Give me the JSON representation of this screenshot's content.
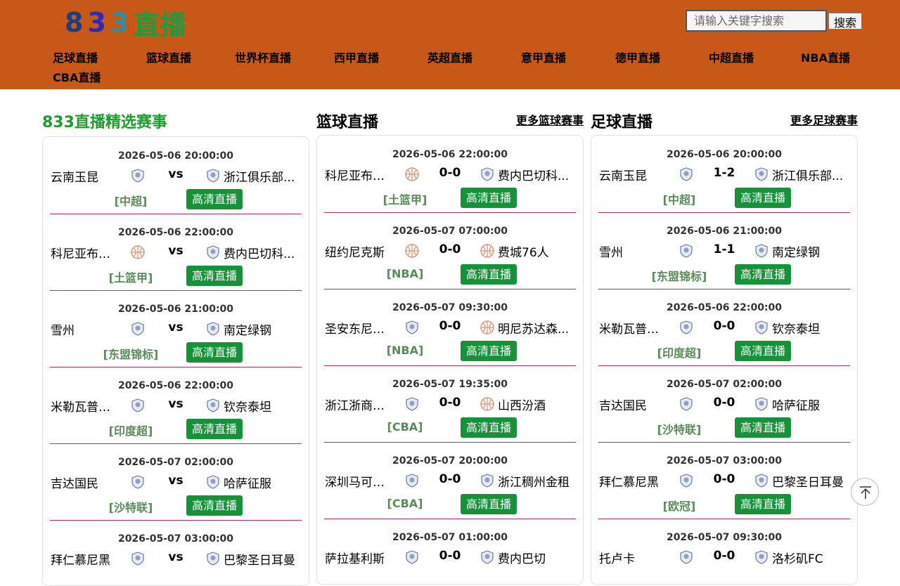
{
  "site": {
    "logo": [
      "8",
      "3",
      "3",
      "直播"
    ],
    "search_placeholder": "请输入关键字搜索",
    "search_button": "搜索"
  },
  "nav": [
    "足球直播",
    "篮球直播",
    "世界杯直播",
    "西甲直播",
    "英超直播",
    "意甲直播",
    "德甲直播",
    "中超直播",
    "NBA直播",
    "CBA直播"
  ],
  "columns": [
    {
      "title": "833直播精选赛事",
      "more": "",
      "matches": [
        {
          "time": "2026-05-06 20:00:00",
          "home": "云南玉昆",
          "score": "vs",
          "away": "浙江俱乐部...",
          "league": "[中超]",
          "live": "高清直播",
          "home_icon": "shield-icon",
          "away_icon": "shield-icon"
        },
        {
          "time": "2026-05-06 22:00:00",
          "home": "科尼亚布于...",
          "score": "vs",
          "away": "费内巴切科...",
          "league": "[土篮甲]",
          "live": "高清直播",
          "home_icon": "ball-icon",
          "away_icon": "shield-icon"
        },
        {
          "time": "2026-05-06 21:00:00",
          "home": "雪州",
          "score": "vs",
          "away": "南定绿钢",
          "league": "[东盟锦标]",
          "live": "高清直播",
          "home_icon": "shield-icon",
          "away_icon": "shield-icon"
        },
        {
          "time": "2026-05-06 22:00:00",
          "home": "米勒瓦普甲比",
          "score": "vs",
          "away": "钦奈泰坦",
          "league": "[印度超]",
          "live": "高清直播",
          "home_icon": "shield-icon",
          "away_icon": "shield-icon"
        },
        {
          "time": "2026-05-07 02:00:00",
          "home": "吉达国民",
          "score": "vs",
          "away": "哈萨征服",
          "league": "[沙特联]",
          "live": "高清直播",
          "home_icon": "shield-icon",
          "away_icon": "shield-icon"
        },
        {
          "time": "2026-05-07 03:00:00",
          "home": "拜仁慕尼黑",
          "score": "vs",
          "away": "巴黎圣日耳曼",
          "league": "",
          "live": "",
          "home_icon": "shield-icon",
          "away_icon": "shield-icon"
        }
      ]
    },
    {
      "title": "篮球直播",
      "more": "更多篮球赛事",
      "matches": [
        {
          "time": "2026-05-06 22:00:00",
          "home": "科尼亚布于...",
          "score": "0-0",
          "away": "费内巴切科...",
          "league": "[土篮甲]",
          "live": "高清直播",
          "home_icon": "ball-icon",
          "away_icon": "shield-icon"
        },
        {
          "time": "2026-05-07 07:00:00",
          "home": "纽约尼克斯",
          "score": "0-0",
          "away": "费城76人",
          "league": "[NBA]",
          "live": "高清直播",
          "home_icon": "ball-icon",
          "away_icon": "ball-icon"
        },
        {
          "time": "2026-05-07 09:30:00",
          "home": "圣安东尼奥...",
          "score": "0-0",
          "away": "明尼苏达森...",
          "league": "[NBA]",
          "live": "高清直播",
          "home_icon": "shield-icon",
          "away_icon": "ball-icon"
        },
        {
          "time": "2026-05-07 19:35:00",
          "home": "浙江浙商证券",
          "score": "0-0",
          "away": "山西汾酒",
          "league": "[CBA]",
          "live": "高清直播",
          "home_icon": "shield-icon",
          "away_icon": "ball-icon"
        },
        {
          "time": "2026-05-07 20:00:00",
          "home": "深圳马可波罗",
          "score": "0-0",
          "away": "浙江稠州金租",
          "league": "[CBA]",
          "live": "高清直播",
          "home_icon": "shield-icon",
          "away_icon": "shield-icon"
        },
        {
          "time": "2026-05-07 01:00:00",
          "home": "萨拉基利斯",
          "score": "0-0",
          "away": "费内巴切",
          "league": "",
          "live": "",
          "home_icon": "shield-icon",
          "away_icon": "shield-icon"
        }
      ]
    },
    {
      "title": "足球直播",
      "more": "更多足球赛事",
      "matches": [
        {
          "time": "2026-05-06 20:00:00",
          "home": "云南玉昆",
          "score": "1-2",
          "away": "浙江俱乐部...",
          "league": "[中超]",
          "live": "高清直播",
          "home_icon": "shield-icon",
          "away_icon": "shield-icon"
        },
        {
          "time": "2026-05-06 21:00:00",
          "home": "雪州",
          "score": "1-1",
          "away": "南定绿钢",
          "league": "[东盟锦标]",
          "live": "高清直播",
          "home_icon": "shield-icon",
          "away_icon": "shield-icon"
        },
        {
          "time": "2026-05-06 22:00:00",
          "home": "米勒瓦普甲比",
          "score": "0-0",
          "away": "钦奈泰坦",
          "league": "[印度超]",
          "live": "高清直播",
          "home_icon": "shield-icon",
          "away_icon": "shield-icon"
        },
        {
          "time": "2026-05-07 02:00:00",
          "home": "吉达国民",
          "score": "0-0",
          "away": "哈萨征服",
          "league": "[沙特联]",
          "live": "高清直播",
          "home_icon": "shield-icon",
          "away_icon": "shield-icon"
        },
        {
          "time": "2026-05-07 03:00:00",
          "home": "拜仁慕尼黑",
          "score": "0-0",
          "away": "巴黎圣日耳曼",
          "league": "[欧冠]",
          "live": "高清直播",
          "home_icon": "shield-icon",
          "away_icon": "shield-icon"
        },
        {
          "time": "2026-05-07 09:30:00",
          "home": "托卢卡",
          "score": "0-0",
          "away": "洛杉矶FC",
          "league": "",
          "live": "",
          "home_icon": "shield-icon",
          "away_icon": "shield-icon"
        }
      ]
    }
  ],
  "colors": {
    "header_bg": "#c85818",
    "live_button": "#18923a",
    "league_text": "#5b8a5b",
    "accent_title": "#1e9c2e",
    "divider": "#b0325a"
  }
}
